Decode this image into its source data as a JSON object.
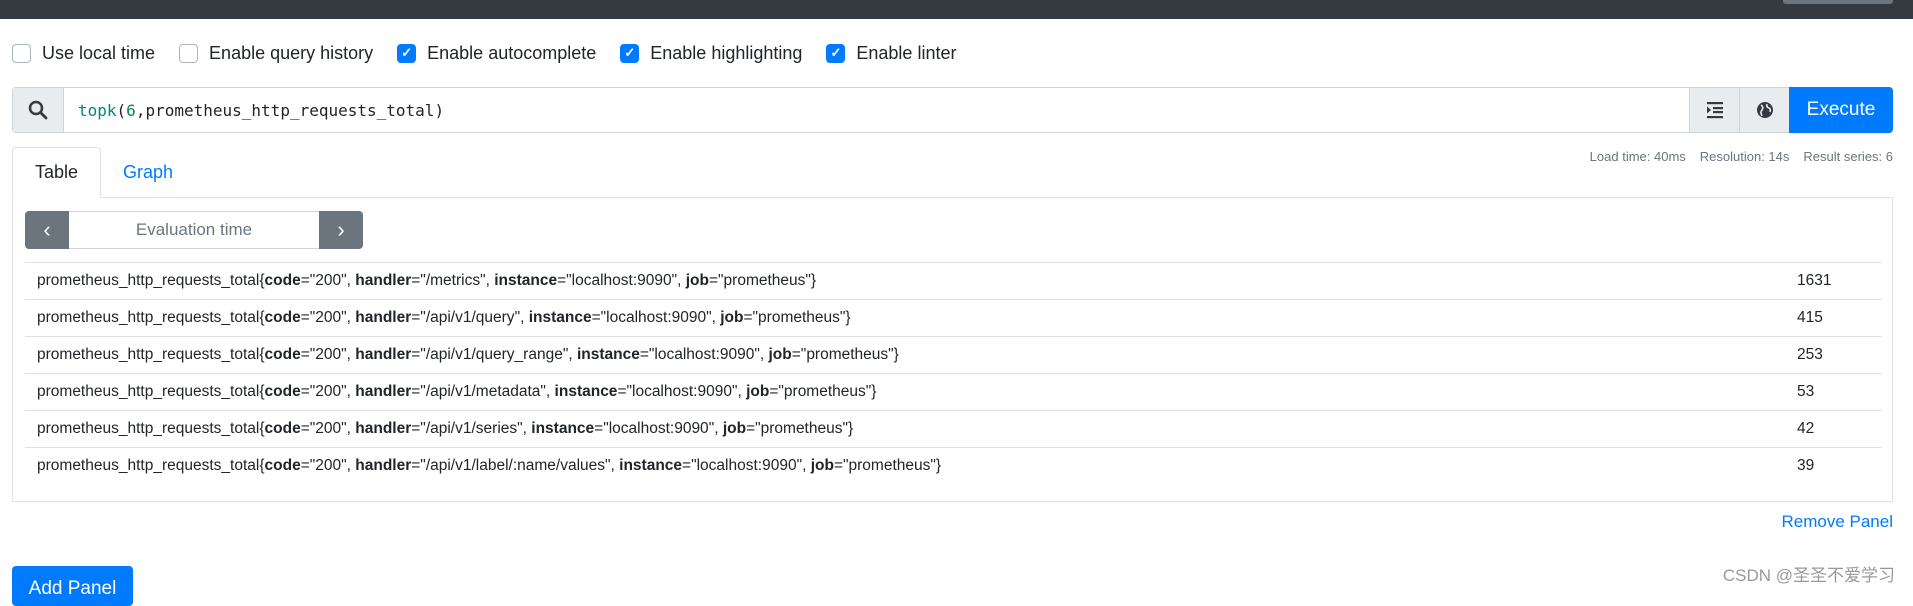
{
  "options": [
    {
      "label": "Use local time",
      "checked": false
    },
    {
      "label": "Enable query history",
      "checked": false
    },
    {
      "label": "Enable autocomplete",
      "checked": true
    },
    {
      "label": "Enable highlighting",
      "checked": true
    },
    {
      "label": "Enable linter",
      "checked": true
    }
  ],
  "query": {
    "fn": "topk",
    "open": "(",
    "num": "6",
    "comma": ",",
    "metric": "prometheus_http_requests_total",
    "close": ")"
  },
  "buttons": {
    "execute": "Execute",
    "add_panel": "Add Panel",
    "remove_panel": "Remove Panel"
  },
  "tabs": [
    {
      "label": "Table",
      "active": true
    },
    {
      "label": "Graph",
      "active": false
    }
  ],
  "stats": {
    "load_time": "Load time: 40ms",
    "resolution": "Resolution: 14s",
    "result_series": "Result series: 6"
  },
  "eval_time_placeholder": "Evaluation time",
  "metric_name": "prometheus_http_requests_total",
  "rows": [
    {
      "handler": "/metrics",
      "value": "1631"
    },
    {
      "handler": "/api/v1/query",
      "value": "415"
    },
    {
      "handler": "/api/v1/query_range",
      "value": "253"
    },
    {
      "handler": "/api/v1/metadata",
      "value": "53"
    },
    {
      "handler": "/api/v1/series",
      "value": "42"
    },
    {
      "handler": "/api/v1/label/:name/values",
      "value": "39"
    }
  ],
  "labels": {
    "code": "200",
    "instance": "localhost:9090",
    "job": "prometheus"
  },
  "watermark": "CSDN @圣圣不爱学习",
  "colors": {
    "accent": "#007bff",
    "topbar": "#343a40",
    "secondary": "#6c757d"
  }
}
